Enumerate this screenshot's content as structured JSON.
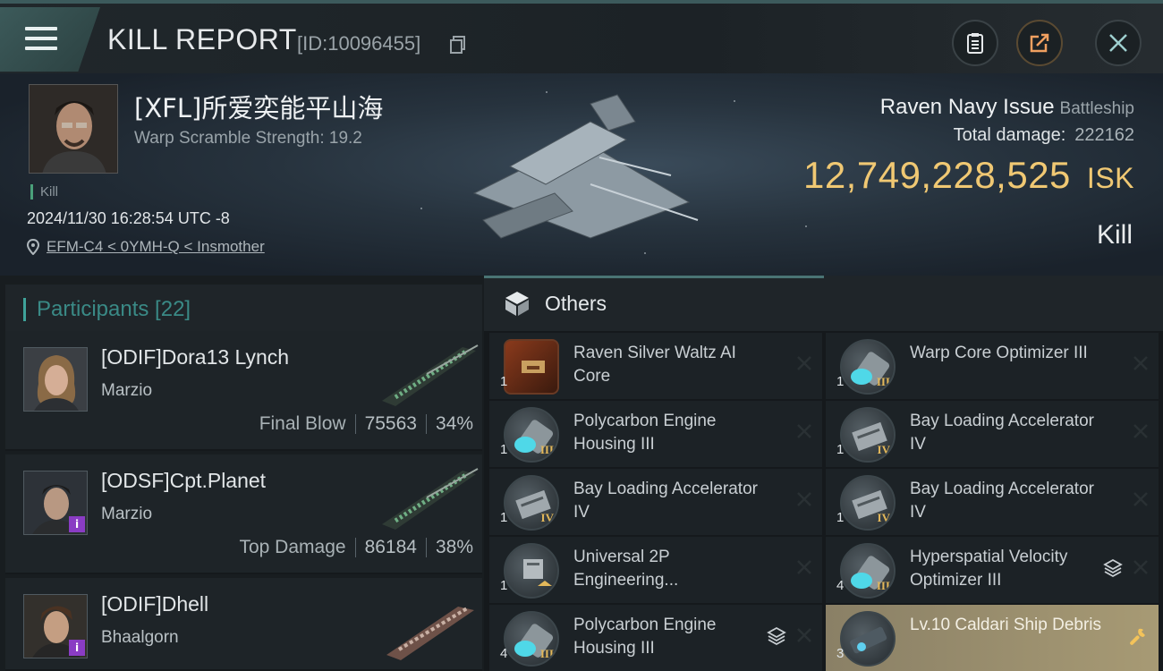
{
  "header": {
    "title": "KILL REPORT",
    "id_label": "[ID:10096455]"
  },
  "victim": {
    "name": "[XFL]所爱奕能平山海",
    "warp_scramble": "Warp Scramble Strength: 19.2",
    "tag": "Kill",
    "timestamp": "2024/11/30 16:28:54 UTC -8",
    "location": "EFM-C4 < 0YMH-Q < Insmother"
  },
  "ship": {
    "name": "Raven Navy Issue",
    "class": "Battleship",
    "total_damage_label": "Total damage:",
    "total_damage": "222162",
    "isk_value": "12,749,228,525",
    "isk_unit": "ISK",
    "result": "Kill"
  },
  "participants": {
    "title": "Participants [22]",
    "rows": [
      {
        "name": "[ODIF]Dora13 Lynch",
        "corp": "Marzio",
        "role": "Final Blow",
        "damage": "75563",
        "percent": "34%"
      },
      {
        "name": "[ODSF]Cpt.Planet",
        "corp": "Marzio",
        "role": "Top Damage",
        "damage": "86184",
        "percent": "38%"
      },
      {
        "name": "[ODIF]Dhell",
        "corp": "Bhaalgorn"
      }
    ]
  },
  "others": {
    "title": "Others",
    "items": [
      {
        "name": "Raven Silver Waltz AI Core",
        "qty": "1",
        "icon": "ai-core-icon"
      },
      {
        "name": "Warp Core Optimizer III",
        "qty": "1",
        "icon": "optimizer-icon",
        "tier": "III"
      },
      {
        "name": "Polycarbon Engine Housing III",
        "qty": "1",
        "icon": "engine-housing-icon",
        "tier": "III"
      },
      {
        "name": "Bay Loading Accelerator IV",
        "qty": "1",
        "icon": "bay-loading-icon",
        "tier": "IV"
      },
      {
        "name": "Bay Loading Accelerator IV",
        "qty": "1",
        "icon": "bay-loading-icon",
        "tier": "IV"
      },
      {
        "name": "Bay Loading Accelerator IV",
        "qty": "1",
        "icon": "bay-loading-icon",
        "tier": "IV"
      },
      {
        "name": "Universal 2P Engineering...",
        "qty": "1",
        "icon": "engineering-icon"
      },
      {
        "name": "Hyperspatial Velocity Optimizer III",
        "qty": "4",
        "icon": "optimizer-icon",
        "tier": "III"
      },
      {
        "name": "Polycarbon Engine Housing III",
        "qty": "4",
        "icon": "engine-housing-icon",
        "tier": "III"
      },
      {
        "name": "Lv.10 Caldari Ship Debris",
        "qty": "3",
        "icon": "debris-icon"
      }
    ]
  },
  "colors": {
    "accent_teal": "#3fa39a",
    "isk_gold": "#f0c873",
    "highlight_gold": "#a79a74",
    "badge_purple": "#8a3cc4"
  }
}
